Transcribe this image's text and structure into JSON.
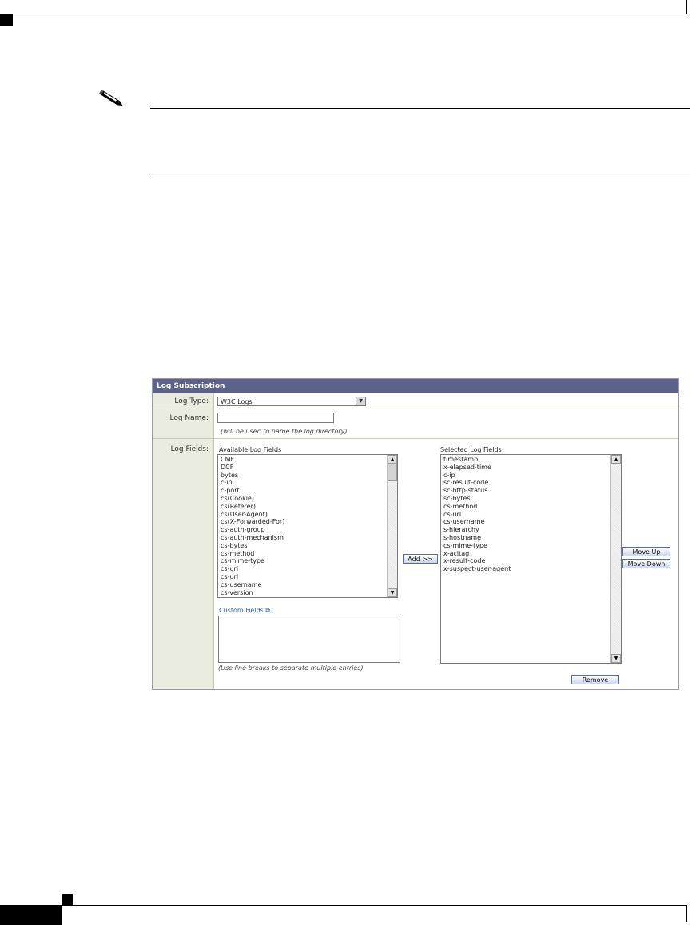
{
  "panel": {
    "header": "Log Subscription",
    "labels": {
      "log_type": "Log Type:",
      "log_name": "Log Name:",
      "log_fields": "Log Fields:"
    },
    "log_type_value": "W3C Logs",
    "log_name_hint": "(will be used to name the log directory)",
    "available_title": "Available Log Fields",
    "available_fields": [
      "CMF",
      "DCF",
      "bytes",
      "c-ip",
      "c-port",
      "cs(Cookie)",
      "cs(Referer)",
      "cs(User-Agent)",
      "cs(X-Forwarded-For)",
      "cs-auth-group",
      "cs-auth-mechanism",
      "cs-bytes",
      "cs-method",
      "cs-mime-type",
      "cs-uri",
      "cs-url",
      "cs-username",
      "cs-version"
    ],
    "selected_title": "Selected Log Fields",
    "selected_fields": [
      "timestamp",
      "x-elapsed-time",
      "c-ip",
      "sc-result-code",
      "sc-http-status",
      "sc-bytes",
      "cs-method",
      "cs-url",
      "cs-username",
      "s-hierarchy",
      "s-hostname",
      "cs-mime-type",
      "x-acltag",
      "x-result-code",
      "x-suspect-user-agent"
    ],
    "add_button": "Add >>",
    "move_up_button": "Move Up",
    "move_down_button": "Move Down",
    "remove_button": "Remove",
    "custom_fields_link": "Custom Fields",
    "custom_fields_hint": "(Use line breaks to separate multiple entries)"
  }
}
